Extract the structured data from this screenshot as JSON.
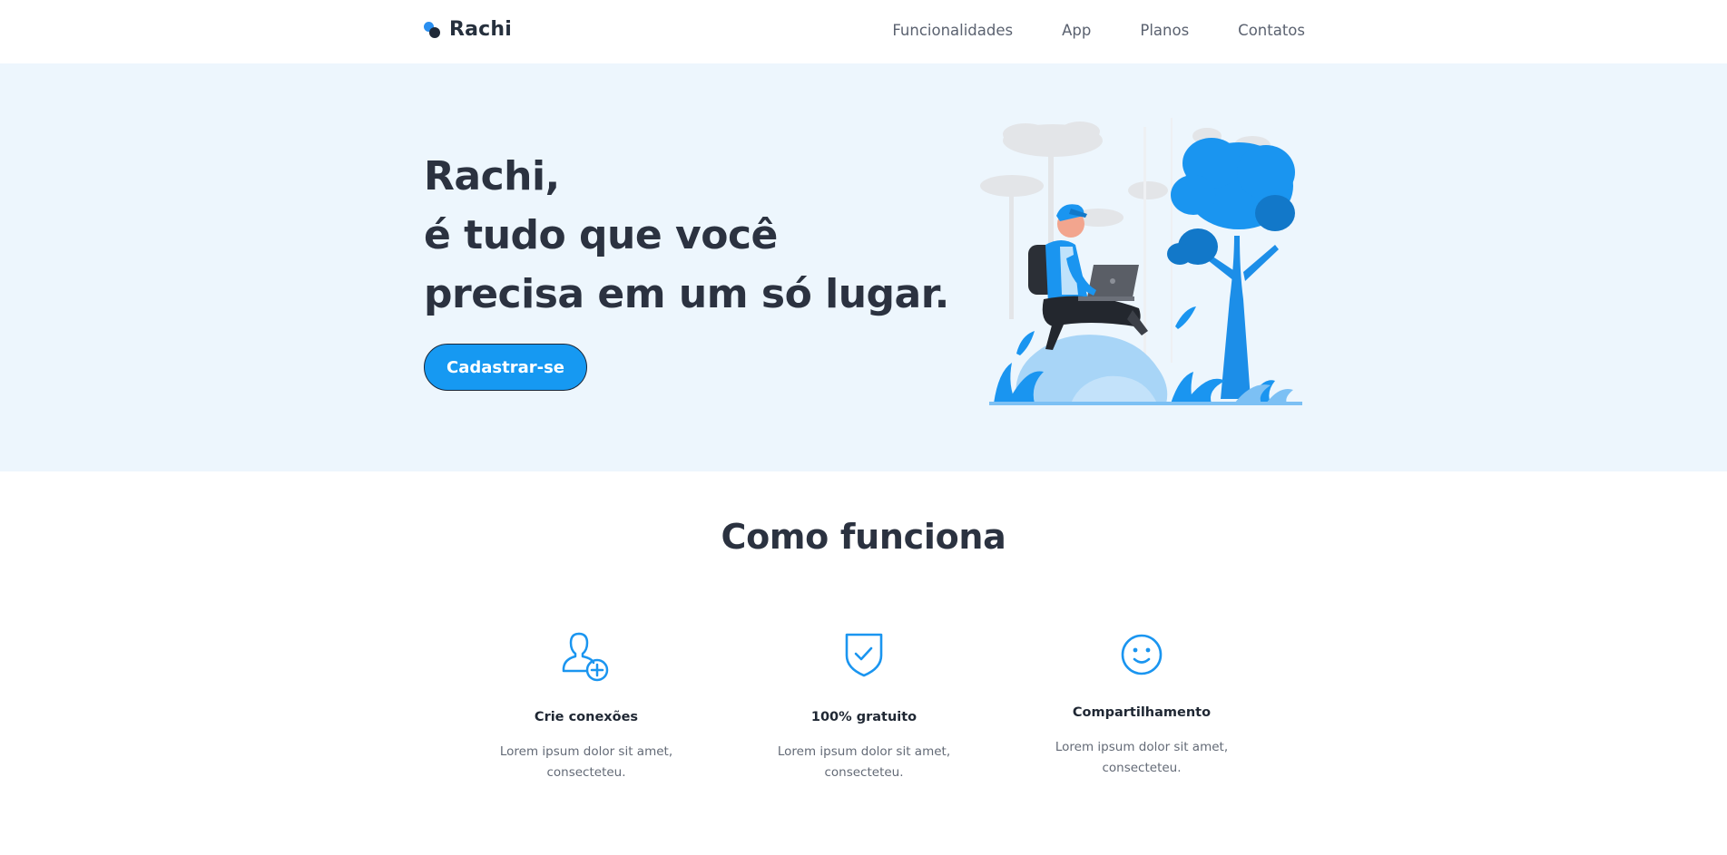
{
  "brand": {
    "name": "Rachi",
    "accent": "#1699f2",
    "dark": "#2b3240"
  },
  "nav": {
    "items": [
      {
        "label": "Funcionalidades"
      },
      {
        "label": "App"
      },
      {
        "label": "Planos"
      },
      {
        "label": "Contatos"
      }
    ]
  },
  "hero": {
    "title_lines": [
      "Rachi,",
      "é tudo que você",
      "precisa em um só lugar."
    ],
    "cta_label": "Cadastrar-se",
    "background": "#edf6fd",
    "illustration": "person-with-laptop-on-rock-illustration"
  },
  "how": {
    "title": "Como funciona",
    "features": [
      {
        "icon": "user-add-icon",
        "title": "Crie conexões",
        "desc_lines": [
          "Lorem ipsum dolor sit amet,",
          "consecteteu."
        ]
      },
      {
        "icon": "shield-check-icon",
        "title": "100% gratuito",
        "desc_lines": [
          "Lorem ipsum dolor sit amet,",
          "consecteteu."
        ]
      },
      {
        "icon": "smiley-icon",
        "title": "Compartilhamento",
        "desc_lines": [
          "Lorem ipsum dolor sit amet,",
          "consecteteu."
        ]
      }
    ]
  }
}
